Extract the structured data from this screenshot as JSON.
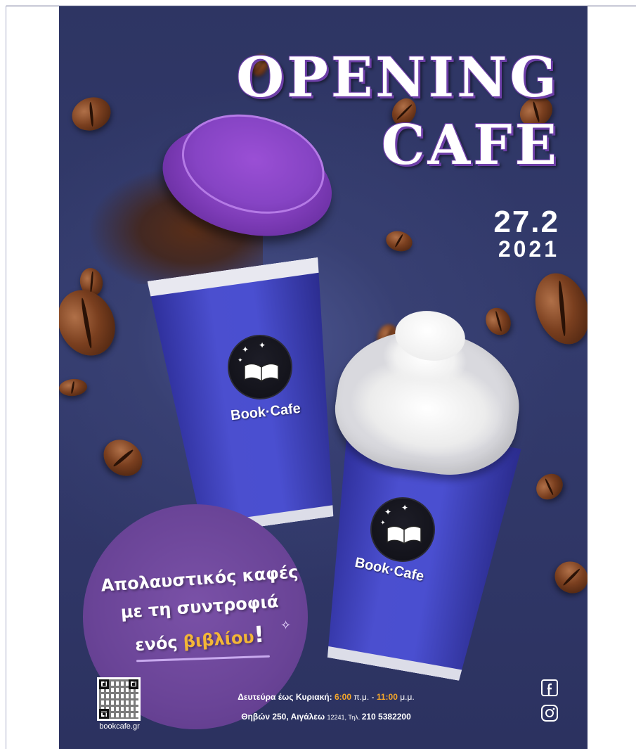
{
  "poster": {
    "title_line1": "OPENING",
    "title_line2": "CAFE",
    "date_day": "27.2",
    "date_year": "2021",
    "brand": "Book·Cafe",
    "tagline": {
      "line1": "Απολαυστικός καφές",
      "line2": "με τη συντροφιά",
      "line3_prefix": "ενός ",
      "line3_highlight": "βιβλίου",
      "line3_suffix": "!"
    },
    "website": "bookcafe.gr",
    "hours": {
      "prefix": "Δευτεύρα έως Κυριακή: ",
      "open_time": "6:00",
      "open_unit": " π.μ. - ",
      "close_time": "11:00",
      "close_unit": " μ.μ."
    },
    "address": {
      "street": "Θηβών 250, Αιγάλεω ",
      "postcode": "12241",
      "phone_label": ", Τηλ. ",
      "phone": "210 5382200"
    },
    "social_icons": [
      "facebook-icon",
      "instagram-icon"
    ]
  },
  "colors": {
    "background": "#2e3563",
    "accent_purple": "#7e3cb8",
    "cup_blue": "#4a4fd0",
    "highlight_orange": "#f4b637"
  }
}
